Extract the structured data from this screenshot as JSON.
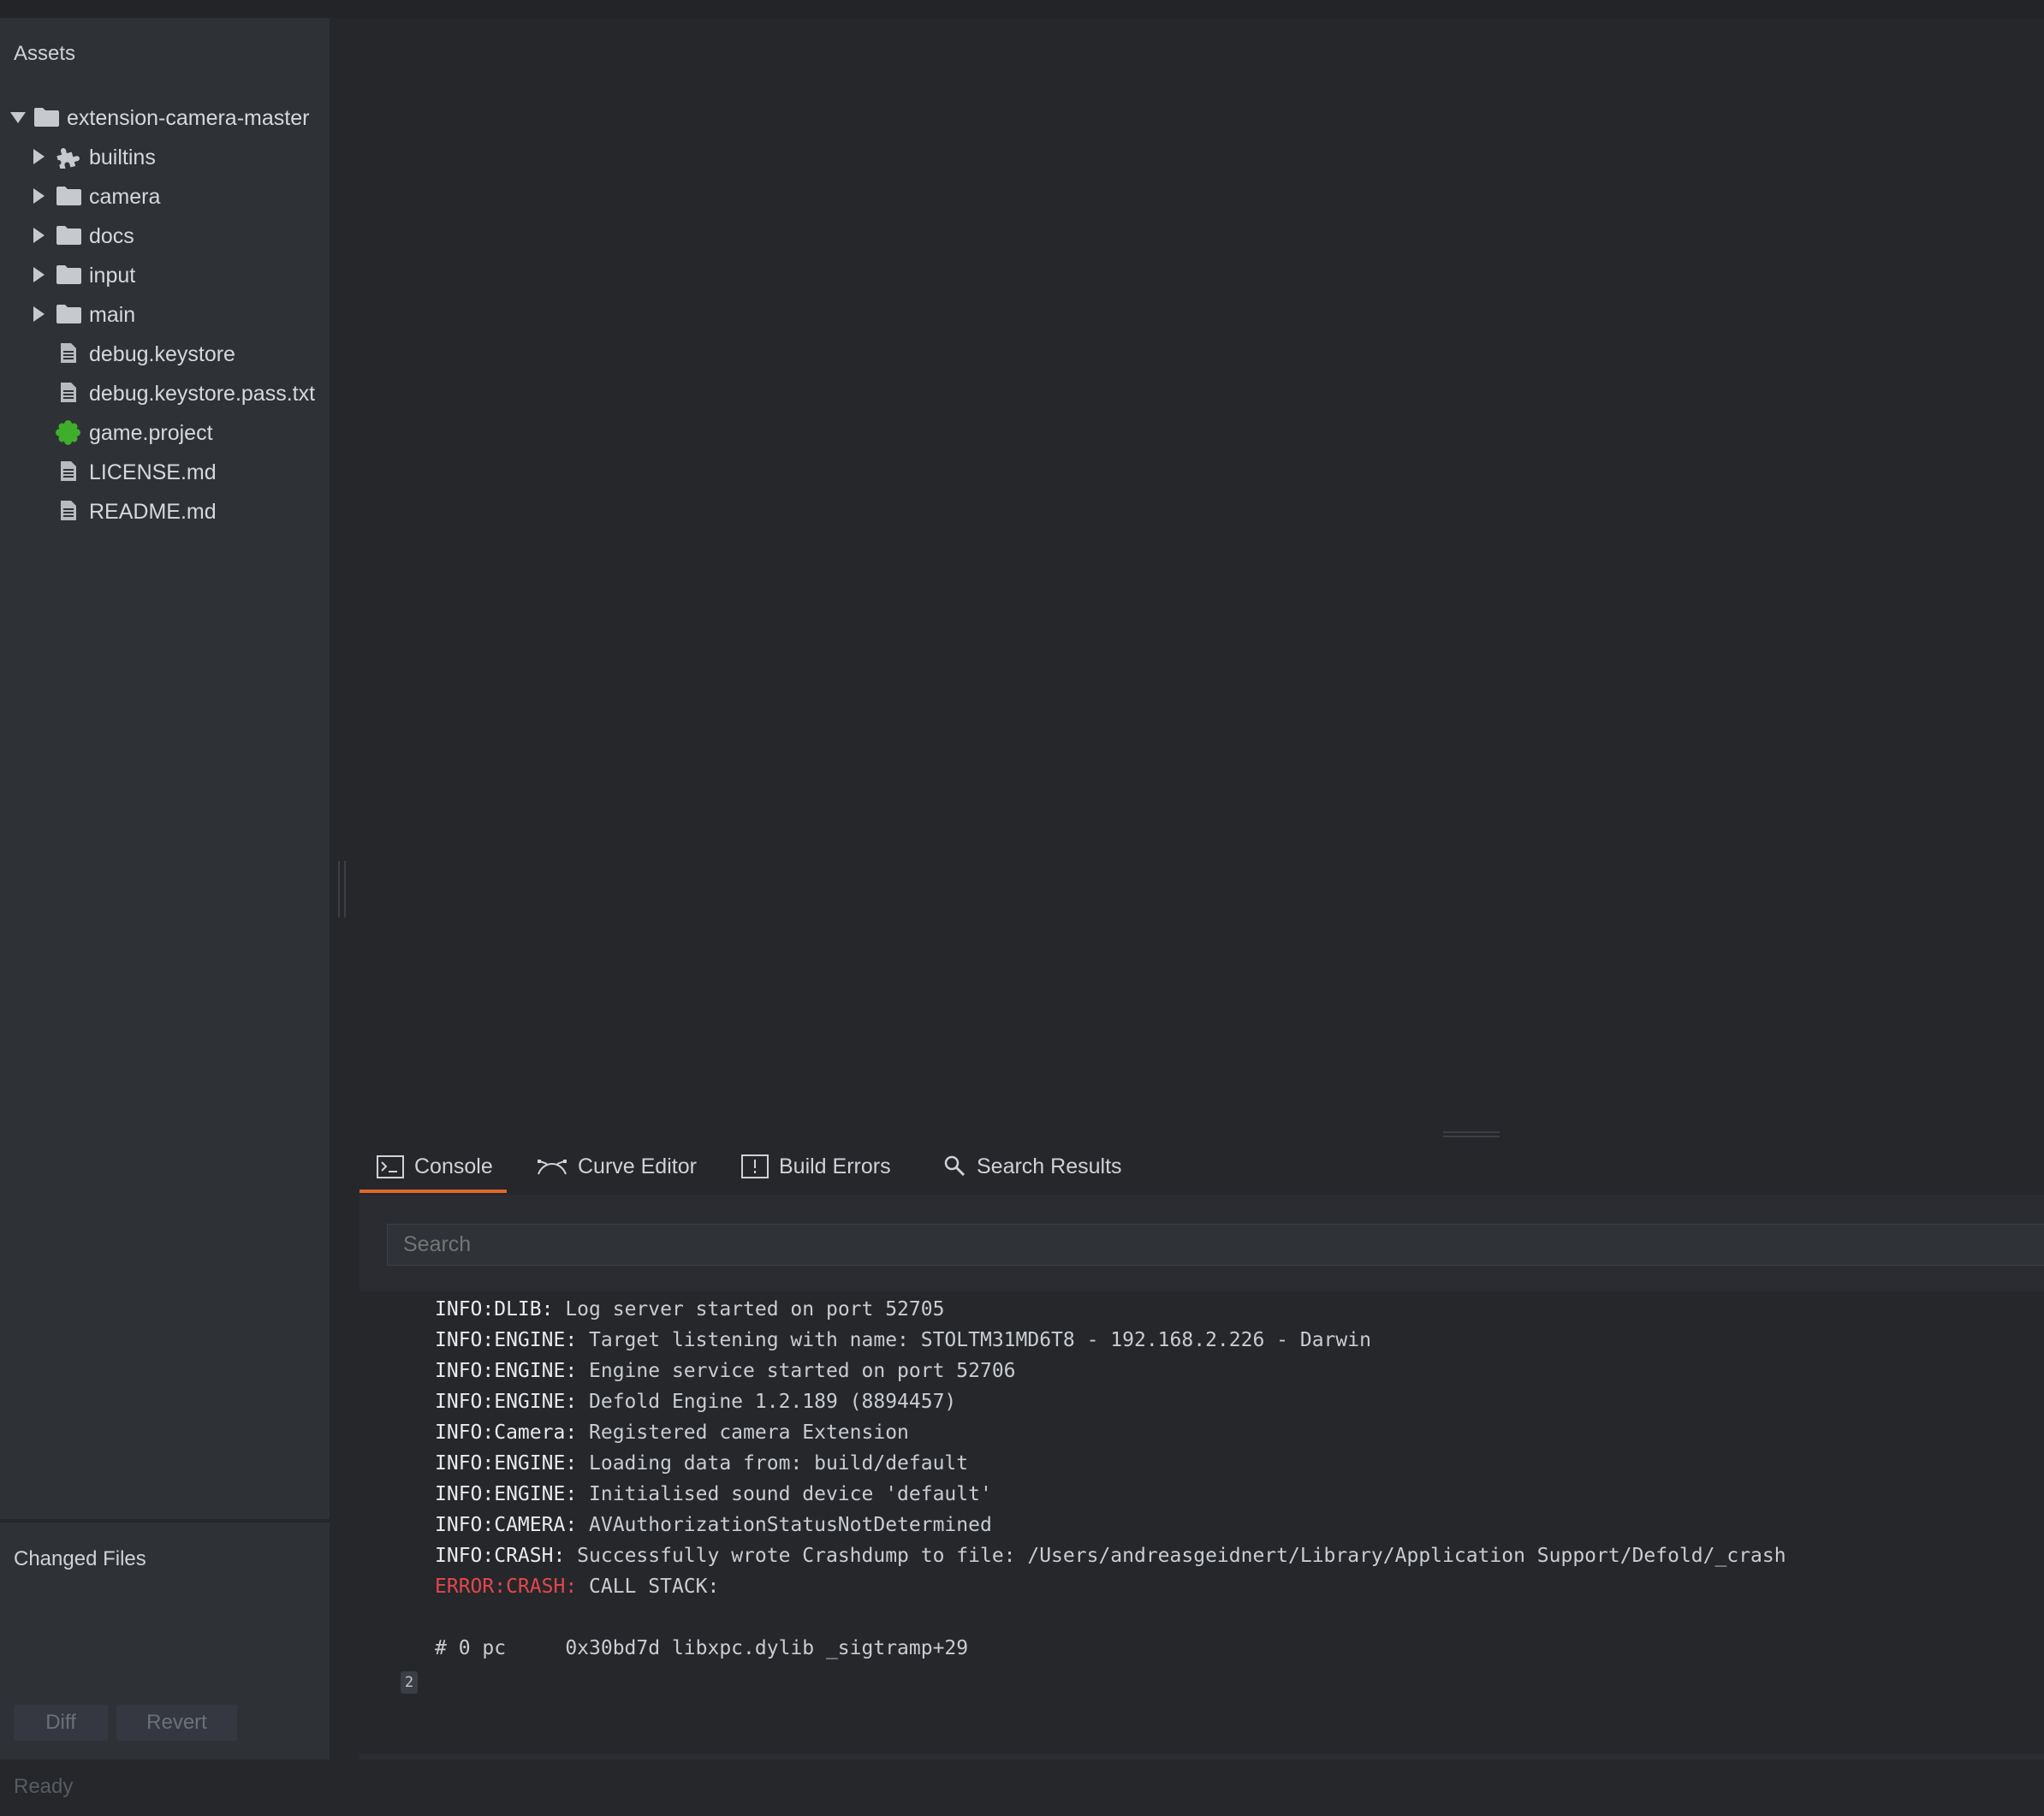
{
  "assets": {
    "title": "Assets",
    "tree": [
      {
        "label": "extension-camera-master",
        "icon": "folder-icon",
        "expanded": true,
        "depth": 0
      },
      {
        "label": "builtins",
        "icon": "puzzle-icon",
        "expanded": false,
        "depth": 1
      },
      {
        "label": "camera",
        "icon": "folder-icon",
        "expanded": false,
        "depth": 1
      },
      {
        "label": "docs",
        "icon": "folder-icon",
        "expanded": false,
        "depth": 1
      },
      {
        "label": "input",
        "icon": "folder-icon",
        "expanded": false,
        "depth": 1
      },
      {
        "label": "main",
        "icon": "folder-icon",
        "expanded": false,
        "depth": 1
      },
      {
        "label": "debug.keystore",
        "icon": "file-icon",
        "depth": 1
      },
      {
        "label": "debug.keystore.pass.txt",
        "icon": "file-icon",
        "depth": 1
      },
      {
        "label": "game.project",
        "icon": "game-project-icon",
        "depth": 1
      },
      {
        "label": "LICENSE.md",
        "icon": "file-icon",
        "depth": 1
      },
      {
        "label": "README.md",
        "icon": "file-icon",
        "depth": 1
      }
    ]
  },
  "changed_files": {
    "title": "Changed Files",
    "diff_label": "Diff",
    "revert_label": "Revert"
  },
  "tabs": [
    {
      "label": "Console",
      "icon": "terminal-icon",
      "active": true
    },
    {
      "label": "Curve Editor",
      "icon": "curve-icon",
      "active": false
    },
    {
      "label": "Build Errors",
      "icon": "warning-box-icon",
      "active": false
    },
    {
      "label": "Search Results",
      "icon": "search-icon",
      "active": false
    }
  ],
  "console": {
    "search_placeholder": "Search",
    "lines": [
      {
        "tag": "INFO:DLIB:",
        "text": " Log server started on port 52705",
        "level": "info"
      },
      {
        "tag": "INFO:ENGINE:",
        "text": " Target listening with name: STOLTM31MD6T8 - 192.168.2.226 - Darwin",
        "level": "info"
      },
      {
        "tag": "INFO:ENGINE:",
        "text": " Engine service started on port 52706",
        "level": "info"
      },
      {
        "tag": "INFO:ENGINE:",
        "text": " Defold Engine 1.2.189 (8894457)",
        "level": "info"
      },
      {
        "tag": "INFO:Camera:",
        "text": " Registered camera Extension",
        "level": "info"
      },
      {
        "tag": "INFO:ENGINE:",
        "text": " Loading data from: build/default",
        "level": "info"
      },
      {
        "tag": "INFO:ENGINE:",
        "text": " Initialised sound device 'default'",
        "level": "info"
      },
      {
        "tag": "INFO:CAMERA:",
        "text": " AVAuthorizationStatusNotDetermined",
        "level": "info"
      },
      {
        "tag": "INFO:CRASH:",
        "text": " Successfully wrote Crashdump to file: /Users/andreasgeidnert/Library/Application Support/Defold/_crash",
        "level": "info"
      },
      {
        "tag": "ERROR:CRASH:",
        "text": " CALL STACK:",
        "level": "error"
      },
      {
        "tag": "",
        "text": "",
        "level": "info"
      },
      {
        "tag": "",
        "text": "# 0 pc     0x30bd7d libxpc.dylib _sigtramp+29",
        "level": "info"
      }
    ],
    "repeat_count": "2"
  },
  "status": {
    "text": "Ready"
  },
  "colors": {
    "accent": "#e0672e",
    "error": "#e2474c",
    "game_project_green": "#3fae2a"
  }
}
